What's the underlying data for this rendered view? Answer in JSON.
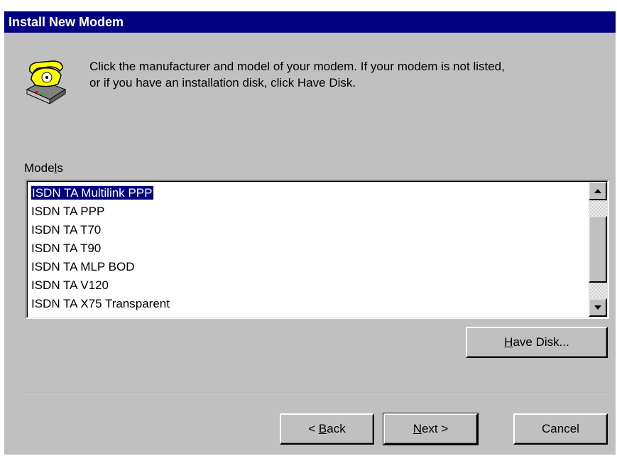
{
  "window": {
    "title": "Install New Modem"
  },
  "instructions": "Click the manufacturer and model of your modem. If your modem is not listed,\nor if you have an installation disk, click Have Disk.",
  "models": {
    "label_pre": "Mode",
    "label_accel": "l",
    "label_post": "s",
    "items": [
      "ISDN TA Multilink PPP",
      "ISDN TA PPP",
      "ISDN TA T70",
      "ISDN TA T90",
      "ISDN TA MLP BOD",
      "ISDN TA V120",
      "ISDN TA X75 Transparent"
    ],
    "selected": "ISDN TA Multilink PPP"
  },
  "buttons": {
    "have_disk": {
      "accel": "H",
      "rest": "ave Disk..."
    },
    "back": {
      "pre": "< ",
      "accel": "B",
      "rest": "ack"
    },
    "next": {
      "accel": "N",
      "rest": "ext >"
    },
    "cancel": "Cancel"
  },
  "icons": {
    "modem": "telephone-modem-icon",
    "scroll_up": "arrow-up-icon",
    "scroll_down": "arrow-down-icon"
  },
  "colors": {
    "titlebar": "#000080",
    "face": "#c0c0c0",
    "selection": "#000080"
  }
}
